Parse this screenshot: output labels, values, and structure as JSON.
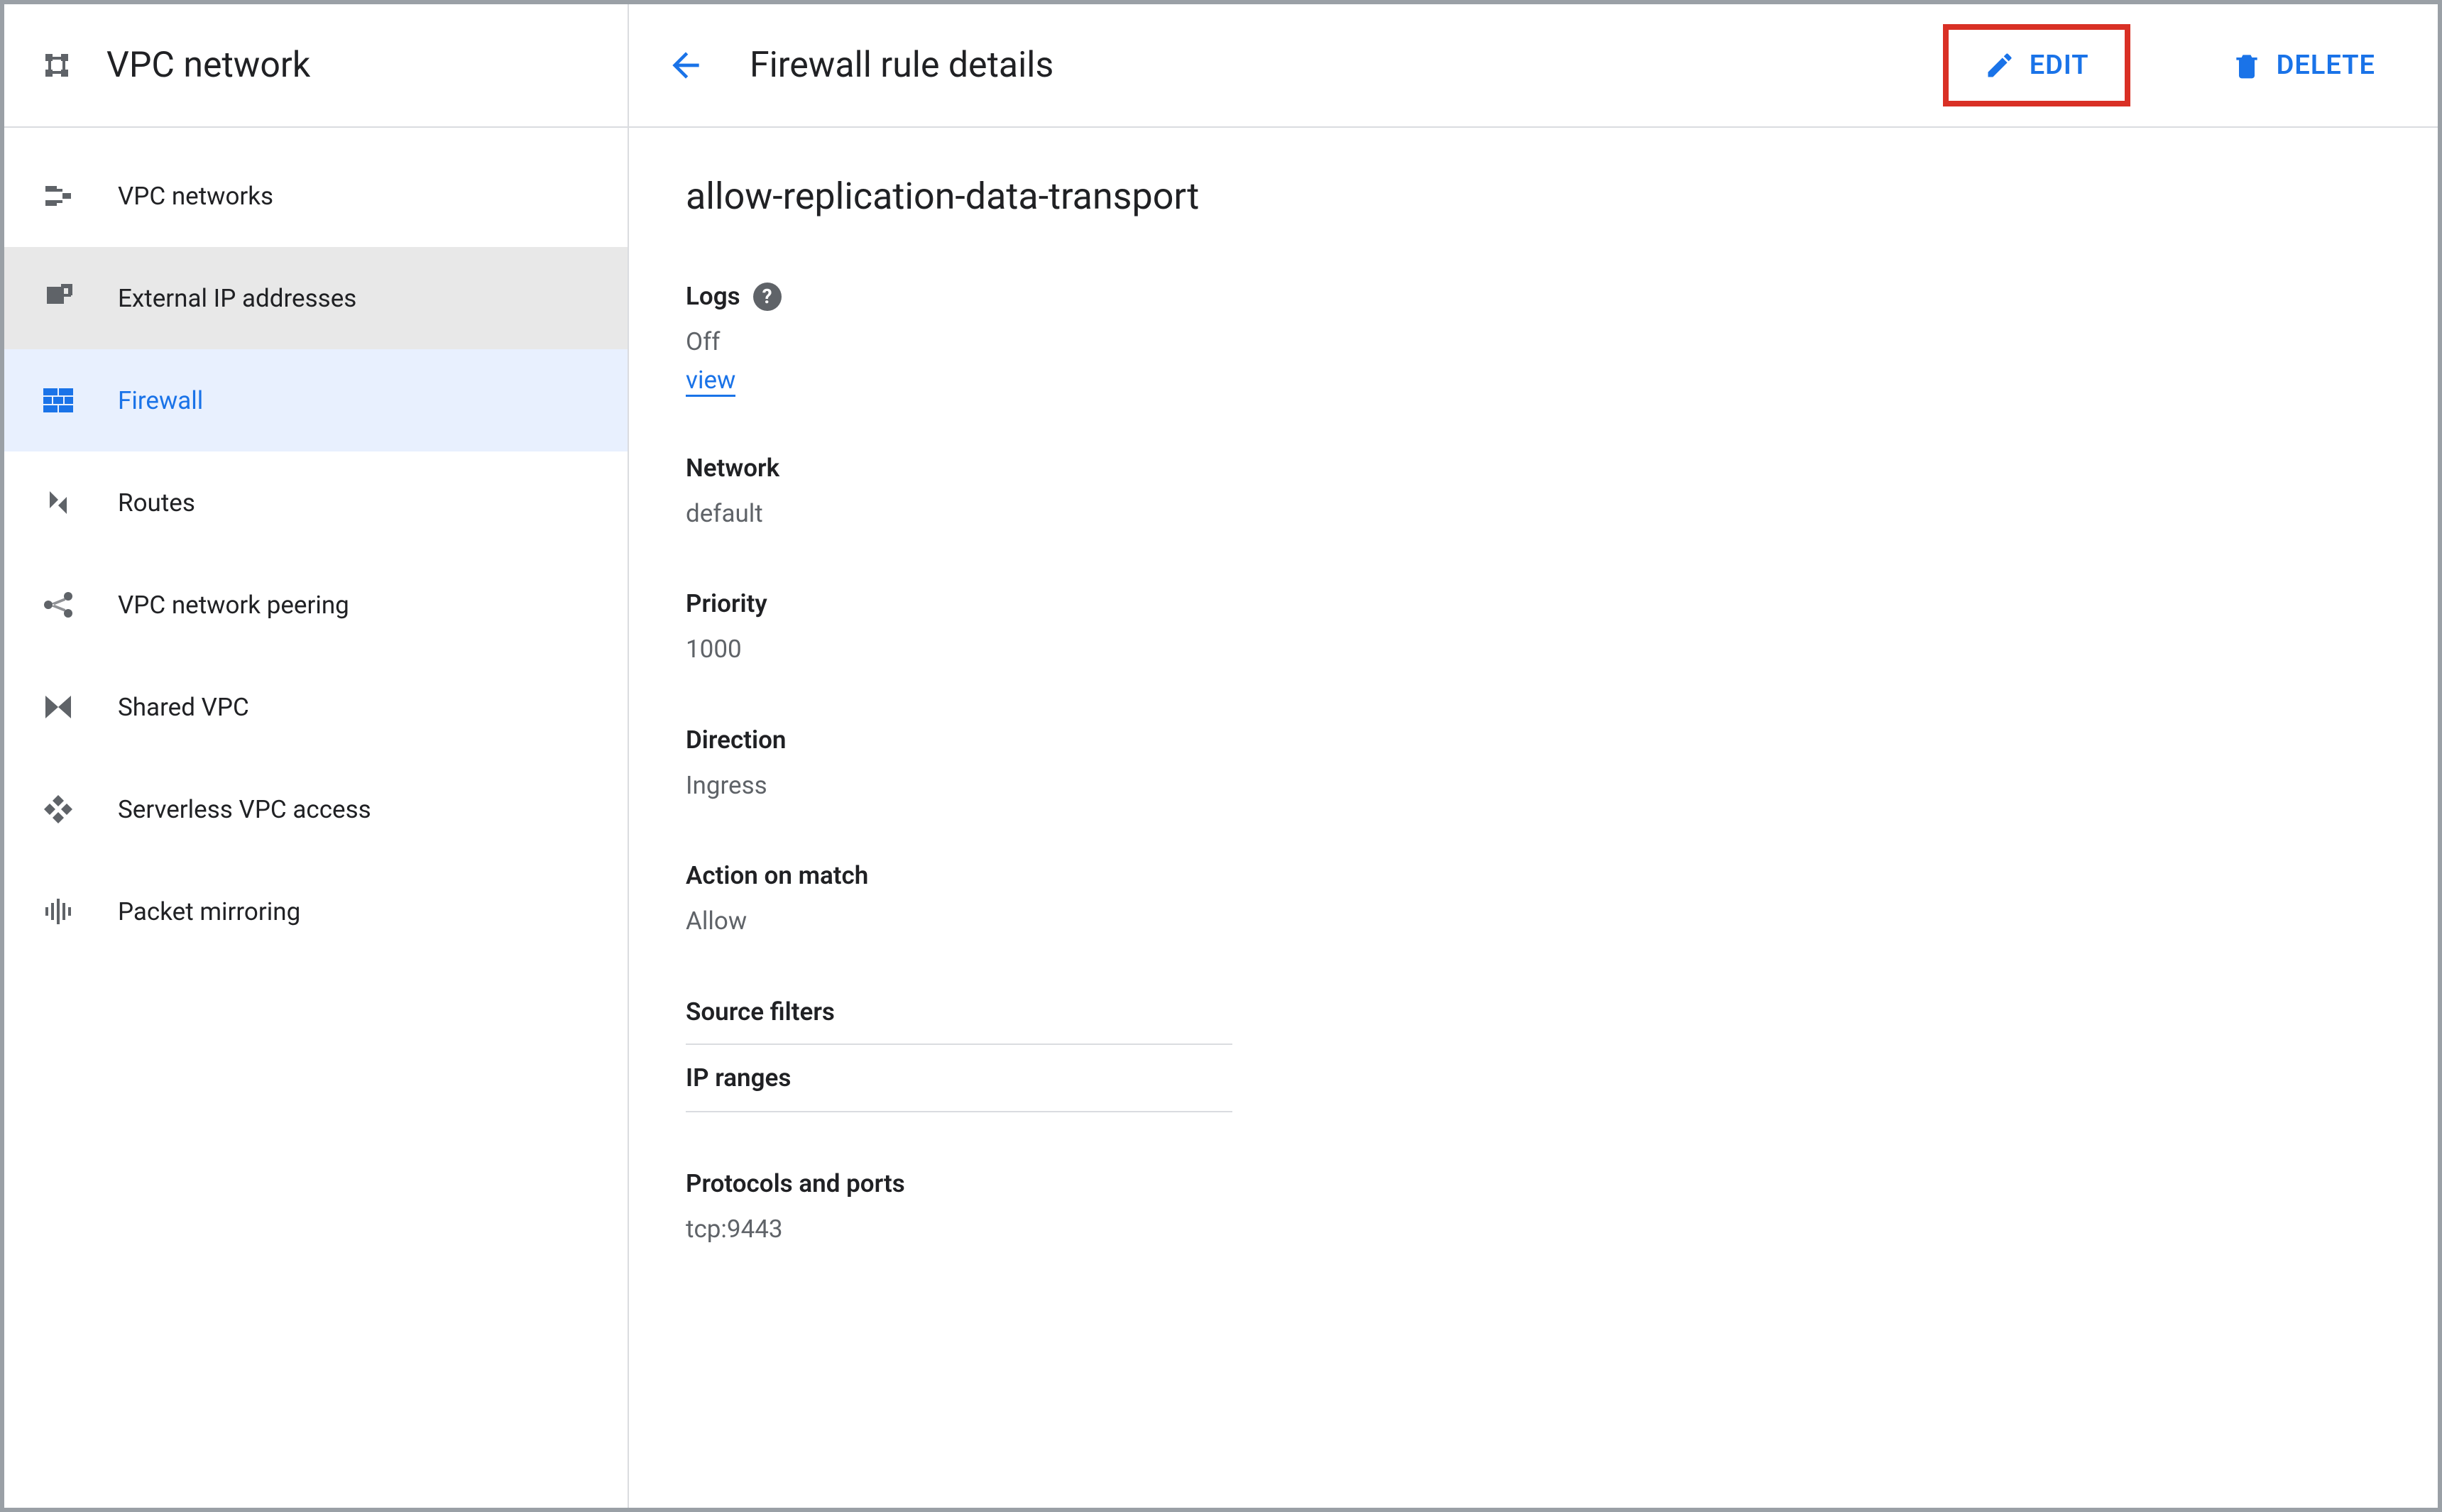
{
  "product": {
    "title": "VPC network"
  },
  "sidebar": {
    "items": [
      {
        "label": "VPC networks"
      },
      {
        "label": "External IP addresses"
      },
      {
        "label": "Firewall"
      },
      {
        "label": "Routes"
      },
      {
        "label": "VPC network peering"
      },
      {
        "label": "Shared VPC"
      },
      {
        "label": "Serverless VPC access"
      },
      {
        "label": "Packet mirroring"
      }
    ]
  },
  "toolbar": {
    "page_title": "Firewall rule details",
    "edit_label": "EDIT",
    "delete_label": "DELETE"
  },
  "rule": {
    "name": "allow-replication-data-transport",
    "logs_label": "Logs",
    "logs_value": "Off",
    "view_link": "view",
    "network_label": "Network",
    "network_value": "default",
    "priority_label": "Priority",
    "priority_value": "1000",
    "direction_label": "Direction",
    "direction_value": "Ingress",
    "action_label": "Action on match",
    "action_value": "Allow",
    "source_filters_label": "Source filters",
    "ip_ranges_label": "IP ranges",
    "protocols_label": "Protocols and ports",
    "protocols_value": "tcp:9443"
  }
}
